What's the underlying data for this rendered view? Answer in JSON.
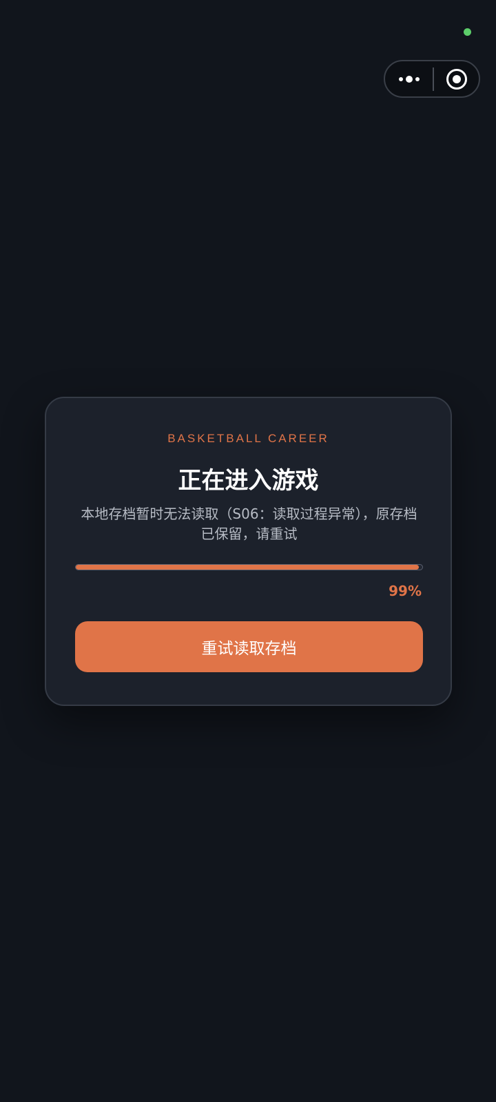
{
  "colors": {
    "accent": "#e07448",
    "status_dot": "#5ccd6a"
  },
  "capsule": {
    "more_icon": "more-dots-icon",
    "close_icon": "target-circle-icon"
  },
  "card": {
    "eyebrow": "BASKETBALL CAREER",
    "title": "正在进入游戏",
    "message": "本地存档暂时无法读取（S06：读取过程异常），原存档已保留，请重试",
    "progress_percent": 99,
    "progress_label": "99%",
    "retry_label": "重试读取存档"
  }
}
